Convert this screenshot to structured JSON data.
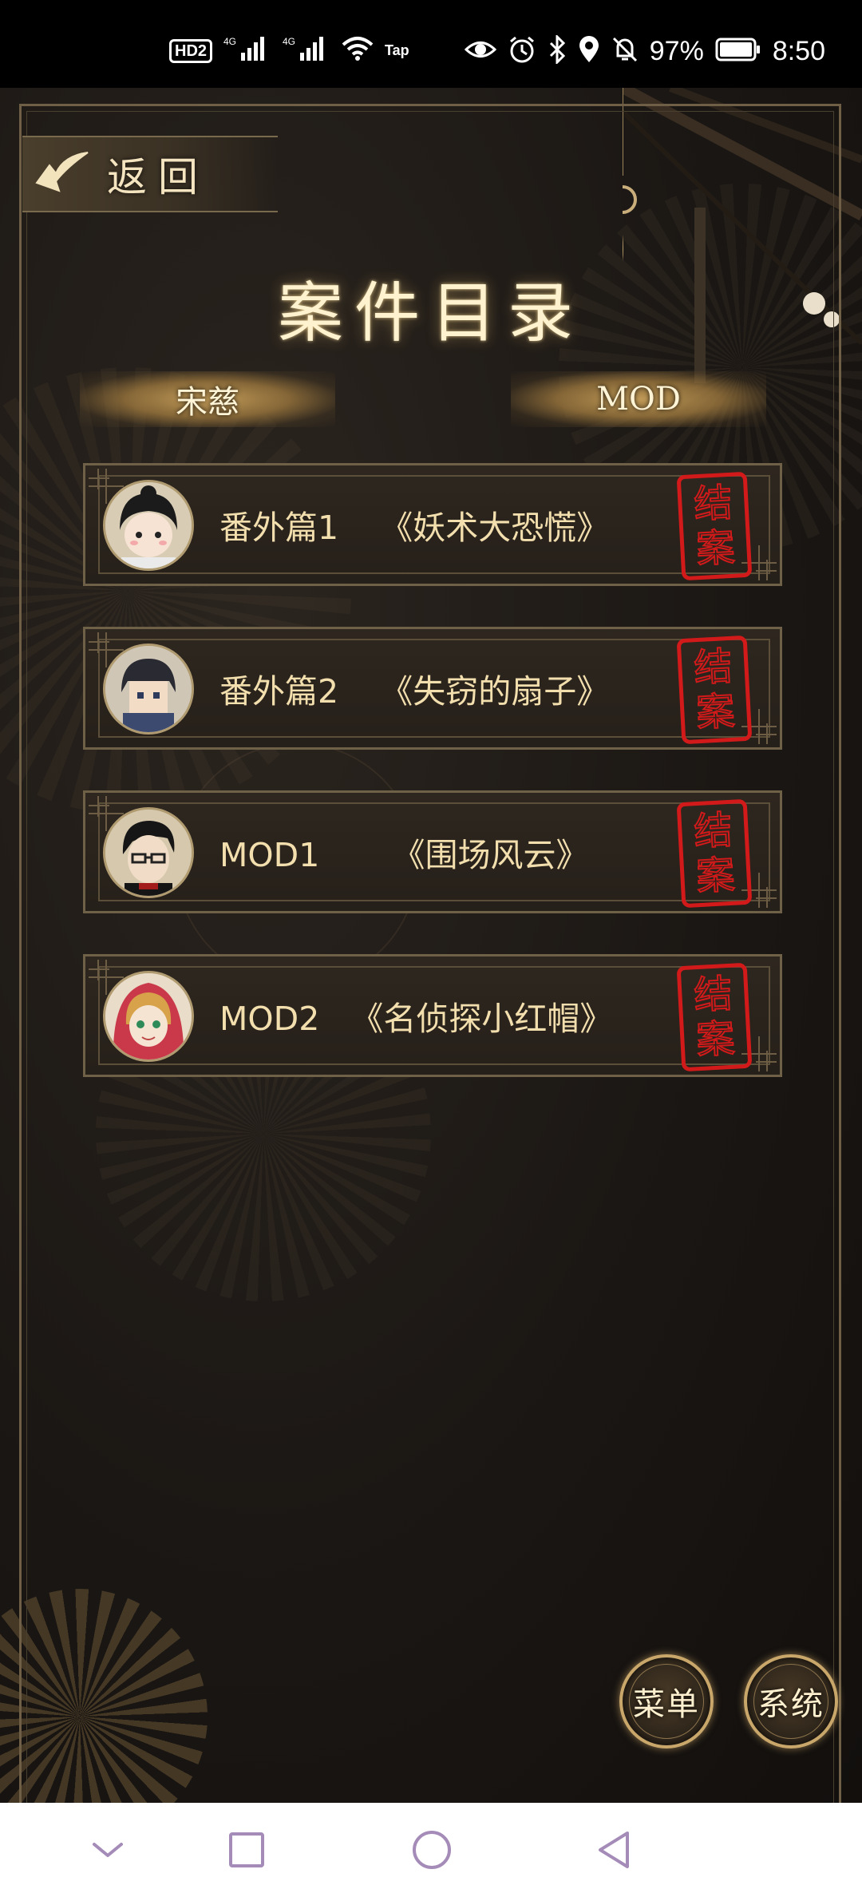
{
  "status_bar": {
    "hd_badge": "HD2",
    "signal1_label": "4G",
    "signal2_label": "4G",
    "tap_label": "Tap",
    "battery_percent": "97%",
    "time": "8:50",
    "icons": [
      "eye-icon",
      "alarm-icon",
      "bluetooth-icon",
      "location-icon",
      "mute-icon",
      "battery-icon"
    ]
  },
  "header": {
    "back_label": "返回",
    "title": "案件目录"
  },
  "tabs": [
    {
      "label": "宋慈"
    },
    {
      "label": "MOD"
    }
  ],
  "cases": [
    {
      "label": "番外篇1    《妖术大恐慌》",
      "stamp": [
        "结",
        "案"
      ]
    },
    {
      "label": "番外篇2    《失窃的扇子》",
      "stamp": [
        "结",
        "案"
      ]
    },
    {
      "label": "MOD1       《围场风云》",
      "stamp": [
        "结",
        "案"
      ]
    },
    {
      "label": "MOD2   《名侦探小红帽》",
      "stamp": [
        "结",
        "案"
      ]
    }
  ],
  "bottom_buttons": {
    "menu_label": "菜单",
    "system_label": "系统"
  },
  "nav": [
    "chevron-down-icon",
    "recent-apps-icon",
    "home-icon",
    "back-icon"
  ]
}
